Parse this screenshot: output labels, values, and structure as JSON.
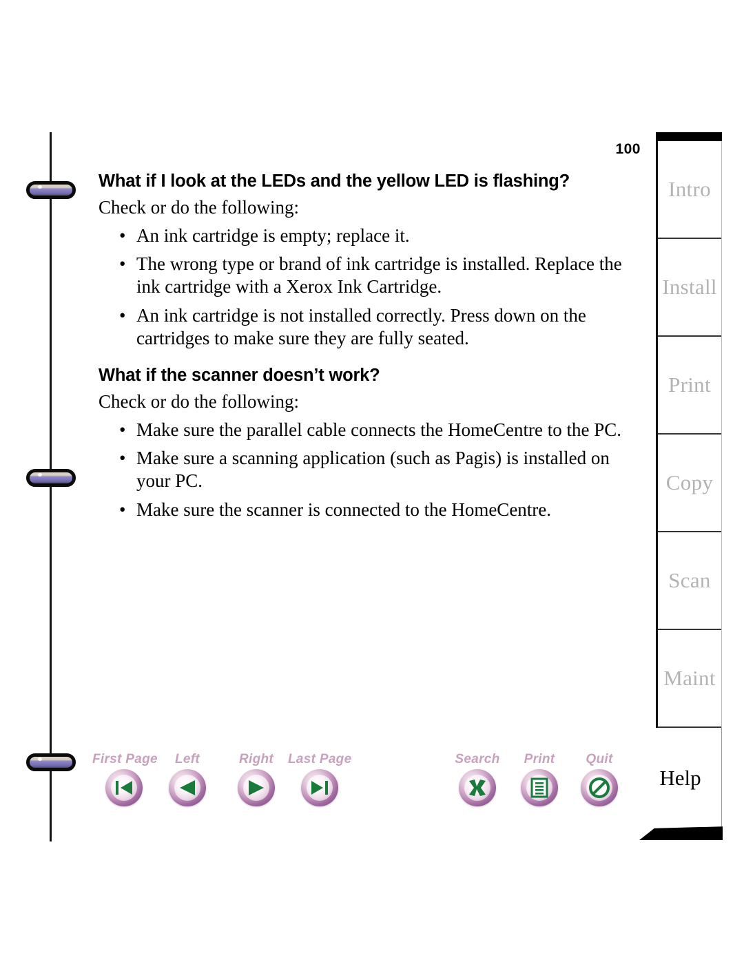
{
  "document": {
    "page_number": "100"
  },
  "content": {
    "sections": [
      {
        "heading": "What if I look at the LEDs and the yellow LED is flashing?",
        "lead": "Check or do the following:",
        "bullets": [
          "An ink cartridge is empty; replace it.",
          "The wrong type or brand of ink cartridge is installed. Replace the ink cartridge with a Xerox Ink Cartridge.",
          "An ink cartridge is not installed correctly. Press down on the cartridges to make sure they are fully seated."
        ]
      },
      {
        "heading": "What if the scanner doesn’t work?",
        "lead": "Check or do the following:",
        "bullets": [
          "Make sure the parallel cable connects the HomeCentre to the PC.",
          "Make sure a scanning application (such as Pagis) is installed on your PC.",
          "Make sure the scanner is connected to the HomeCentre."
        ]
      }
    ],
    "bullet_glyph": "•"
  },
  "toolbar": {
    "buttons": [
      {
        "label": "First Page",
        "icon": "first-page-icon"
      },
      {
        "label": "Left",
        "icon": "previous-page-icon"
      },
      {
        "label": "Right",
        "icon": "next-page-icon"
      },
      {
        "label": "Last Page",
        "icon": "last-page-icon"
      },
      {
        "label": "Search",
        "icon": "search-icon"
      },
      {
        "label": "Print",
        "icon": "print-icon"
      },
      {
        "label": "Quit",
        "icon": "quit-icon"
      }
    ]
  },
  "tabs": {
    "items": [
      {
        "label": "Intro",
        "active": false
      },
      {
        "label": "Install",
        "active": false
      },
      {
        "label": "Print",
        "active": false
      },
      {
        "label": "Copy",
        "active": false
      },
      {
        "label": "Scan",
        "active": false
      },
      {
        "label": "Maint",
        "active": false
      }
    ],
    "help": {
      "label": "Help",
      "active": true
    }
  },
  "colors": {
    "tab_inactive_text": "#b3b3b3",
    "tab_active_text": "#000000",
    "toolbar_label": "#c8a2bd",
    "toolbar_glyph": "#1a7a3c",
    "binder_ring": "#7d74bb"
  }
}
